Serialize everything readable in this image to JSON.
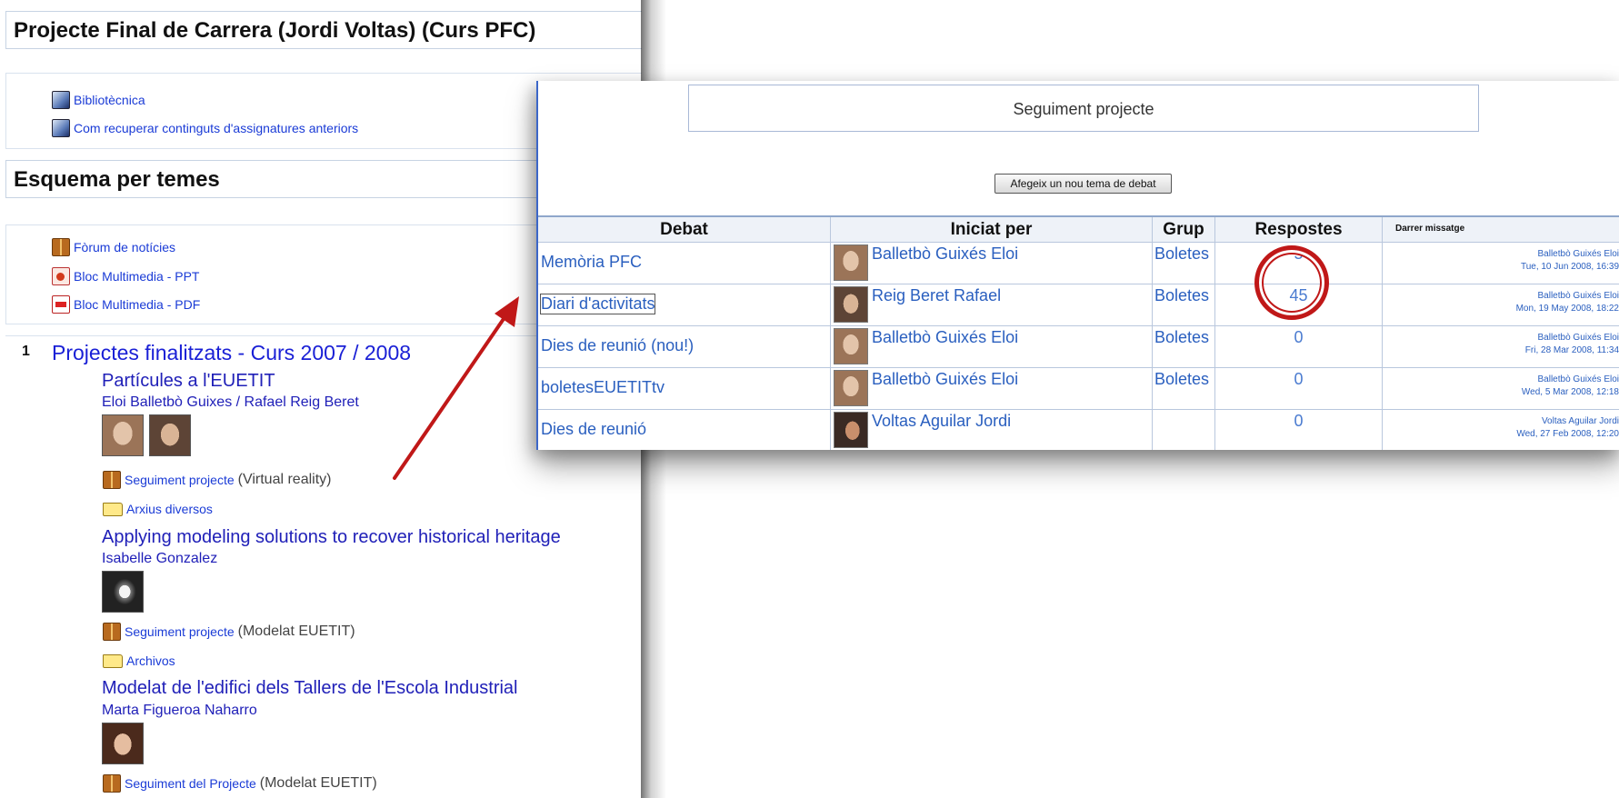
{
  "course": {
    "title": "Projecte Final de Carrera (Jordi Voltas) (Curs PFC)",
    "links": [
      {
        "label": "Bibliotècnica",
        "icon": "web-page-icon"
      },
      {
        "label": "Com recuperar continguts d'assignatures anteriors",
        "icon": "web-page-icon"
      }
    ],
    "section_heading": "Esquema per temes",
    "resources": [
      {
        "label": "Fòrum de notícies",
        "icon": "forum-icon"
      },
      {
        "label": "Bloc Multimedia - PPT",
        "icon": "ppt-icon"
      },
      {
        "label": "Bloc Multimedia - PDF",
        "icon": "pdf-icon"
      }
    ],
    "topic": {
      "number": "1",
      "title": "Projectes finalitzats - Curs 2007 / 2008",
      "projects": [
        {
          "title": "Partícules a l'EUETIT",
          "authors": "Eloi Balletbò Guixes / Rafael Reig Beret",
          "forum": "Seguiment projecte",
          "forum_note": "(Virtual reality)",
          "folder": "Arxius diversos"
        },
        {
          "title": "Applying modeling solutions to recover historical heritage",
          "authors": "Isabelle Gonzalez",
          "forum": "Seguiment projecte",
          "forum_note": "(Modelat EUETIT)",
          "folder": "Archivos"
        },
        {
          "title": "Modelat de l'edifici dels Tallers de l'Escola Industrial",
          "authors": "Marta Figueroa Naharro",
          "forum": "Seguiment del Projecte",
          "forum_note": "(Modelat EUETIT)"
        }
      ]
    }
  },
  "forum_popup": {
    "title": "Seguiment projecte",
    "add_button": "Afegeix un nou tema de debat",
    "headers": [
      "Debat",
      "Iniciat per",
      "Grup",
      "Respostes",
      "Darrer missatge"
    ],
    "rows": [
      {
        "debat": "Memòria PFC",
        "iniciat": "Balletbò Guixés Eloi",
        "grup": "Boletes",
        "respostes": "5",
        "last_by": "Balletbò Guixés Eloi",
        "last_date": "Tue, 10 Jun 2008, 16:39"
      },
      {
        "debat": "Diari d'activitats",
        "iniciat": "Reig Beret Rafael",
        "grup": "Boletes",
        "respostes": "45",
        "last_by": "Balletbò Guixés Eloi",
        "last_date": "Mon, 19 May 2008, 18:22"
      },
      {
        "debat": "Dies de reunió (nou!)",
        "iniciat": "Balletbò Guixés Eloi",
        "grup": "Boletes",
        "respostes": "0",
        "last_by": "Balletbò Guixés Eloi",
        "last_date": "Fri, 28 Mar 2008, 11:34"
      },
      {
        "debat": "boletesEUETITtv",
        "iniciat": "Balletbò Guixés Eloi",
        "grup": "Boletes",
        "respostes": "0",
        "last_by": "Balletbò Guixés Eloi",
        "last_date": "Wed, 5 Mar 2008, 12:18"
      },
      {
        "debat": "Dies de reunió",
        "iniciat": "Voltas Aguilar Jordi",
        "grup": "",
        "respostes": "0",
        "last_by": "Voltas Aguilar Jordi",
        "last_date": "Wed, 27 Feb 2008, 12:20"
      }
    ]
  },
  "colors": {
    "link": "#1a3bd6",
    "annotation_red": "#c01818",
    "table_border": "#b9c7dd"
  }
}
